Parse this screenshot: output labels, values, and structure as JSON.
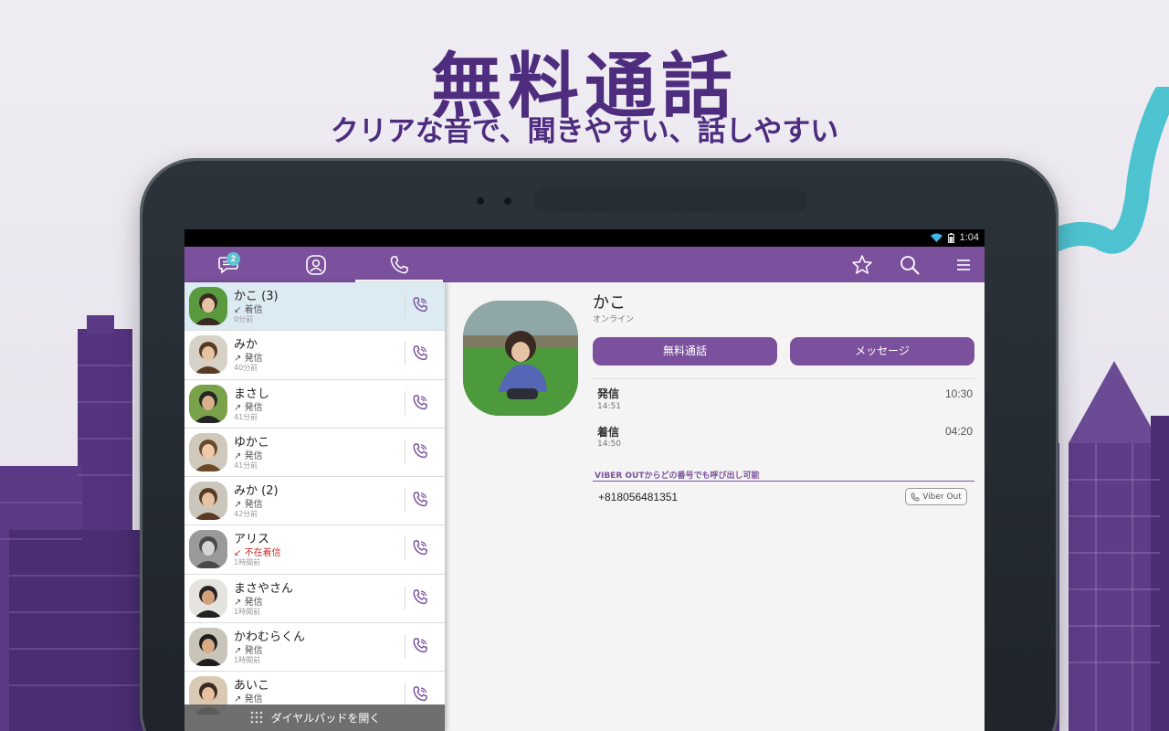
{
  "promo": {
    "headline": "無料通話",
    "subheadline": "クリアな音で、聞きやすい、話しやすい"
  },
  "statusbar": {
    "time": "1:04"
  },
  "appbar": {
    "tabs": [
      {
        "icon": "chat-icon",
        "badge": "2",
        "active": false
      },
      {
        "icon": "contacts-icon",
        "active": false
      },
      {
        "icon": "phone-icon",
        "active": true
      }
    ],
    "actions": [
      "star-icon",
      "search-icon",
      "menu-icon"
    ]
  },
  "call_list": [
    {
      "name": "かこ (3)",
      "type": "着信",
      "direction": "incoming",
      "time": "0分前",
      "selected": true
    },
    {
      "name": "みか",
      "type": "発信",
      "direction": "outgoing",
      "time": "40分前"
    },
    {
      "name": "まさし",
      "type": "発信",
      "direction": "outgoing",
      "time": "41分前"
    },
    {
      "name": "ゆかこ",
      "type": "発信",
      "direction": "outgoing",
      "time": "41分前"
    },
    {
      "name": "みか (2)",
      "type": "発信",
      "direction": "outgoing",
      "time": "42分前"
    },
    {
      "name": "アリス",
      "type": "不在着信",
      "direction": "missed",
      "time": "1時間前"
    },
    {
      "name": "まさやさん",
      "type": "発信",
      "direction": "outgoing",
      "time": "1時間前"
    },
    {
      "name": "かわむらくん",
      "type": "発信",
      "direction": "outgoing",
      "time": "1時間前"
    },
    {
      "name": "あいこ",
      "type": "発信",
      "direction": "outgoing",
      "time": ""
    }
  ],
  "dialpad_label": "ダイヤルパッドを開く",
  "detail": {
    "name": "かこ",
    "status": "オンライン",
    "free_call_label": "無料通話",
    "message_label": "メッセージ",
    "history": [
      {
        "label": "発信",
        "time": "14:51",
        "duration": "10:30"
      },
      {
        "label": "着信",
        "time": "14:50",
        "duration": "04:20"
      }
    ],
    "viber_out_header": "VIBER OUTからどの番号でも呼び出し可能",
    "phone_number": "+818056481351",
    "viber_out_button": "Viber Out"
  },
  "colors": {
    "brand_purple": "#7b519d",
    "headline_purple": "#4e2d7f",
    "badge_teal": "#5ec2d3",
    "missed_red": "#cc2a2a"
  }
}
